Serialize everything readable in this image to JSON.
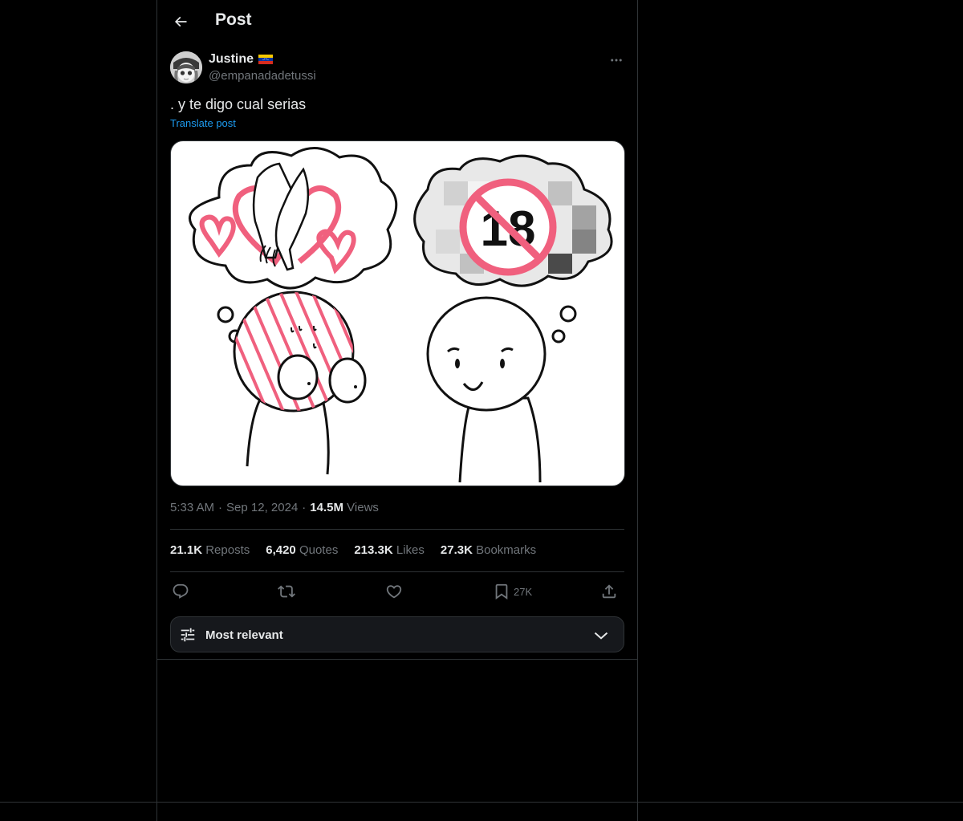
{
  "header": {
    "title": "Post"
  },
  "author": {
    "name": "Justine",
    "handle": "@empanadadetussi"
  },
  "post": {
    "text": ". y te digo cual serias",
    "translate_label": "Translate post",
    "image_badge_text": "18"
  },
  "meta": {
    "time": "5:33 AM",
    "date": "Sep 12, 2024",
    "views_count": "14.5M",
    "views_label": "Views"
  },
  "stats": {
    "reposts_count": "21.1K",
    "reposts_label": "Reposts",
    "quotes_count": "6,420",
    "quotes_label": "Quotes",
    "likes_count": "213.3K",
    "likes_label": "Likes",
    "bookmarks_count": "27.3K",
    "bookmarks_label": "Bookmarks"
  },
  "actions": {
    "bookmark_count": "27K"
  },
  "sort": {
    "label": "Most relevant"
  },
  "colors": {
    "background": "#000000",
    "text": "#e7e9ea",
    "muted": "#71767b",
    "link": "#1d9bf0",
    "border": "#2f3336",
    "illustration_pink": "#f0607e"
  },
  "icons": [
    "back-arrow-icon",
    "more-icon",
    "reply-icon",
    "repost-icon",
    "like-icon",
    "bookmark-icon",
    "share-icon",
    "sliders-icon",
    "chevron-down-icon",
    "flag-icon"
  ]
}
